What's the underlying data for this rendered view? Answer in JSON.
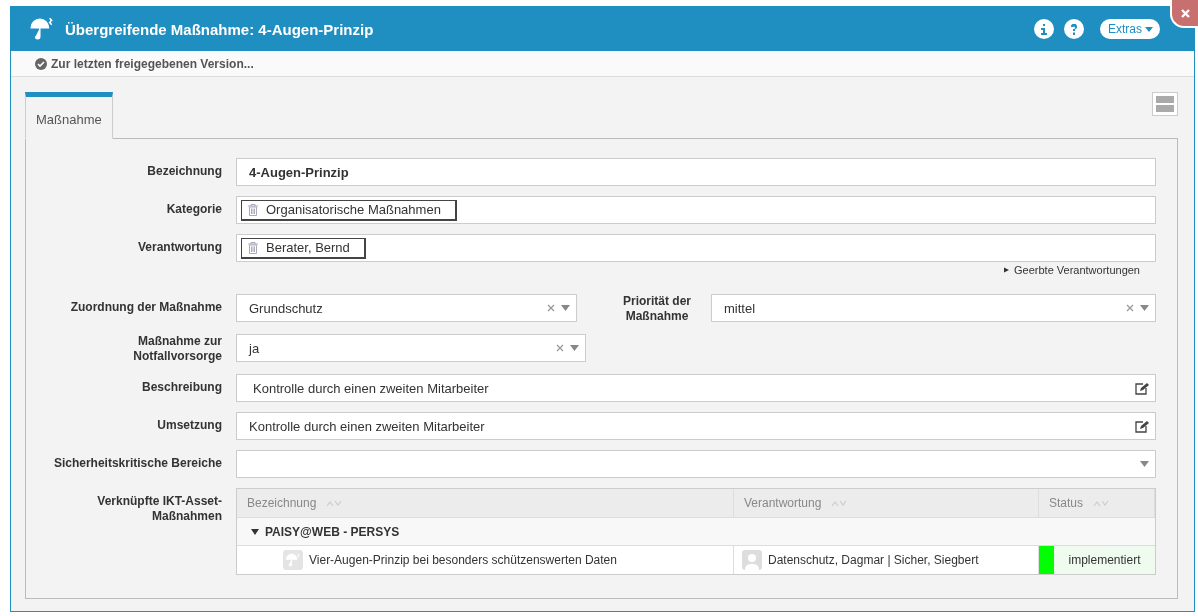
{
  "window": {
    "title": "Übergreifende Maßnahme: 4-Augen-Prinzip",
    "extras_button": "Extras"
  },
  "toolbar": {
    "link": "Zur letzten freigegebenen Version..."
  },
  "tabs": [
    {
      "label": "Maßnahme",
      "selected": true
    }
  ],
  "form": {
    "name": {
      "label": "Bezeichnung",
      "value": "4-Augen-Prinzip"
    },
    "category": {
      "label": "Kategorie",
      "tags": [
        "Organisatorische Maßnahmen"
      ]
    },
    "responsibility": {
      "label": "Verantwortung",
      "tags": [
        "Berater, Bernd"
      ]
    },
    "inherited_link": {
      "label": "Geerbte Verantwortungen",
      "expanded": false
    },
    "assignment": {
      "label": "Zuordnung der Maßnahme",
      "value": "Grundschutz"
    },
    "priority": {
      "label": "Priorität der Maßnahme",
      "value": "mittel"
    },
    "emergency": {
      "label": "Maßnahme zur Notfallvorsorge",
      "value": "ja"
    },
    "description": {
      "label": "Beschreibung",
      "value": "Kontrolle durch einen zweiten Mitarbeiter"
    },
    "implementation": {
      "label": "Umsetzung",
      "value": "Kontrolle durch einen zweiten Mitarbeiter"
    },
    "critical_areas": {
      "label": "Sicherheitskritische Bereiche"
    },
    "linked_measures": {
      "label": "Verknüpfte IKT-Asset-Maßnahmen",
      "table": {
        "columns": [
          "Bezeichnung",
          "Verantwortung",
          "Status"
        ],
        "groups": [
          {
            "name": "PAISY@WEB - PERSYS",
            "expanded": true,
            "rows": [
              {
                "name": "Vier-Augen-Prinzip bei besonders schützenswerten Daten",
                "responsible": "Datenschutz, Dagmar | Sicher, Siegbert",
                "status": "implementiert",
                "color": "#00ff00"
              }
            ]
          }
        ]
      }
    }
  }
}
